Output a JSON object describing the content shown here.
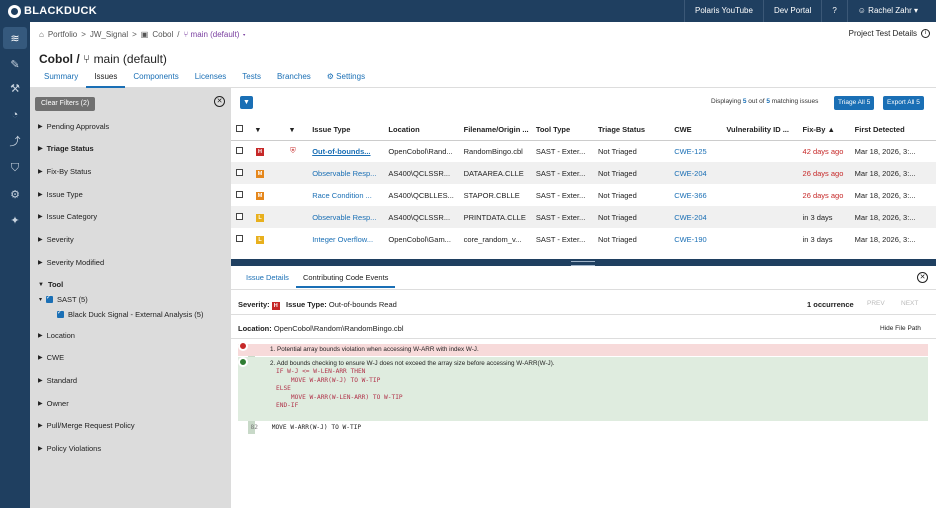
{
  "topbar": {
    "brand": "BLACKDUCK",
    "links": [
      "Polaris YouTube",
      "Dev Portal"
    ],
    "user": "Rachel Zahr"
  },
  "header": {
    "breadcrumb": {
      "portfolio": "Portfolio",
      "project": "JW_Signal",
      "app": "Cobol",
      "branch": "main (default)"
    },
    "title": "Cobol",
    "branch_title": "main (default)",
    "project_details": "Project Test Details",
    "tabs": [
      "Summary",
      "Issues",
      "Components",
      "Licenses",
      "Tests",
      "Branches",
      "Settings"
    ]
  },
  "filters": {
    "clear": "Clear Filters (2)",
    "sections": [
      "Pending Approvals",
      "Triage Status",
      "Fix-By Status",
      "Issue Type",
      "Issue Category",
      "Severity",
      "Severity Modified",
      "Tool",
      "Location",
      "CWE",
      "Standard",
      "Owner",
      "Pull/Merge Request Policy",
      "Policy Violations"
    ],
    "tool_sub": "SAST (5)",
    "tool_sub2": "Black Duck Signal - External Analysis (5)"
  },
  "toolbar": {
    "displaying": "Displaying",
    "shown": "5",
    "outof": "out of",
    "total": "5",
    "matching": "matching issues",
    "triage_all": "Triage All 5",
    "export_all": "Export All 5"
  },
  "table": {
    "headers": [
      "Issue Type",
      "Location",
      "Filename/Origin ...",
      "Tool Type",
      "Triage Status",
      "CWE",
      "Vulnerability ID ...",
      "Fix-By",
      "First Detected"
    ],
    "rows": [
      {
        "sev": "H",
        "type": "Out-of-bounds...",
        "loc": "OpenCobol\\Rand...",
        "file": "RandomBingo.cbl",
        "tool": "SAST - Exter...",
        "triage": "Not Triaged",
        "cwe": "CWE-125",
        "vid": "",
        "fix": "42 days ago",
        "first": "Mar 18, 2026, 3:..."
      },
      {
        "sev": "M",
        "type": "Observable Resp...",
        "loc": "AS400\\QCLSSR...",
        "file": "DATAAREA.CLLE",
        "tool": "SAST - Exter...",
        "triage": "Not Triaged",
        "cwe": "CWE-204",
        "vid": "",
        "fix": "26 days ago",
        "first": "Mar 18, 2026, 3:..."
      },
      {
        "sev": "M",
        "type": "Race Condition ...",
        "loc": "AS400\\QCBLLES...",
        "file": "STAPOR.CBLLE",
        "tool": "SAST - Exter...",
        "triage": "Not Triaged",
        "cwe": "CWE-366",
        "vid": "",
        "fix": "26 days ago",
        "first": "Mar 18, 2026, 3:..."
      },
      {
        "sev": "L",
        "type": "Observable Resp...",
        "loc": "AS400\\QCLSSR...",
        "file": "PRINTDATA.CLLE",
        "tool": "SAST - Exter...",
        "triage": "Not Triaged",
        "cwe": "CWE-204",
        "vid": "",
        "fix": "in 3 days",
        "first": "Mar 18, 2026, 3:..."
      },
      {
        "sev": "L",
        "type": "Integer Overflow...",
        "loc": "OpenCobol\\Gam...",
        "file": "core_random_v...",
        "tool": "SAST - Exter...",
        "triage": "Not Triaged",
        "cwe": "CWE-190",
        "vid": "",
        "fix": "in 3 days",
        "first": "Mar 18, 2026, 3:..."
      }
    ]
  },
  "detail": {
    "tabs": [
      "Issue Details",
      "Contributing Code Events"
    ],
    "severity_label": "Severity:",
    "sev": "H",
    "issue_type_label": "Issue Type:",
    "issue_type": "Out-of-bounds Read",
    "occurrence": "1 occurrence",
    "prev": "PREV",
    "next": "NEXT",
    "location_label": "Location:",
    "location": "OpenCobol\\Random\\RandomBingo.cbl",
    "hide_path": "Hide File Path",
    "event1": "1. Potential array bounds violation when accessing W-ARR with index W-J.",
    "event2": "2. Add bounds checking to ensure W-J does not exceed the array size before accessing W-ARR(W-J).",
    "code": [
      "IF W-J <= W-LEN-ARR THEN",
      "    MOVE W-ARR(W-J) TO W-TIP",
      "ELSE",
      "    MOVE W-ARR(W-LEN-ARR) TO W-TIP",
      "END-IF"
    ],
    "line_no": "82",
    "line_code": "MOVE W-ARR(W-J) TO W-TIP"
  }
}
